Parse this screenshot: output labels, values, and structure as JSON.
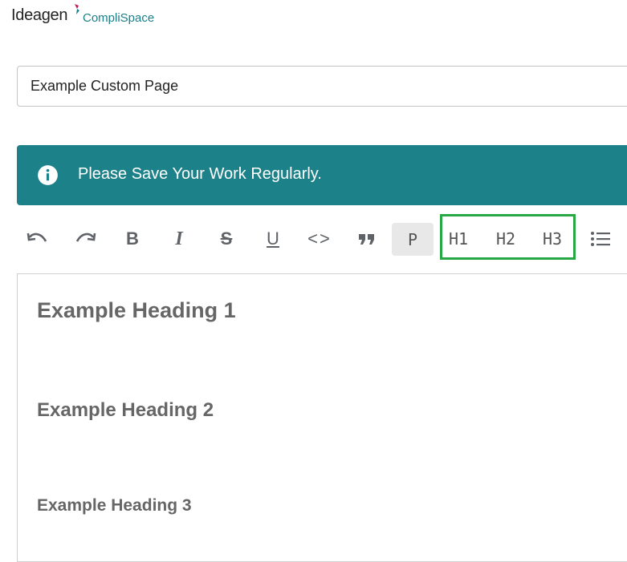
{
  "logo": {
    "brand": "Ideagen",
    "product": "CompliSpace"
  },
  "title_input": {
    "value": "Example Custom Page"
  },
  "banner": {
    "icon": "info-icon",
    "message": "Please Save Your Work Regularly."
  },
  "toolbar": {
    "buttons": [
      {
        "name": "undo-icon"
      },
      {
        "name": "redo-icon"
      },
      {
        "name": "bold-icon",
        "label": "B"
      },
      {
        "name": "italic-icon",
        "label": "I"
      },
      {
        "name": "strikethrough-icon",
        "label": "S"
      },
      {
        "name": "underline-icon",
        "label": "U"
      },
      {
        "name": "code-icon",
        "label": "<>"
      },
      {
        "name": "blockquote-icon"
      },
      {
        "name": "paragraph-button",
        "label": "P",
        "active": true
      },
      {
        "name": "heading1-button",
        "label": "H1"
      },
      {
        "name": "heading2-button",
        "label": "H2"
      },
      {
        "name": "heading3-button",
        "label": "H3"
      },
      {
        "name": "bullet-list-icon"
      }
    ]
  },
  "editor": {
    "heading1": "Example Heading 1",
    "heading2": "Example Heading 2",
    "heading3": "Example Heading 3"
  },
  "colors": {
    "banner": "#1c8188",
    "highlight": "#28a745",
    "brand_accent": "#1a7f8a"
  }
}
